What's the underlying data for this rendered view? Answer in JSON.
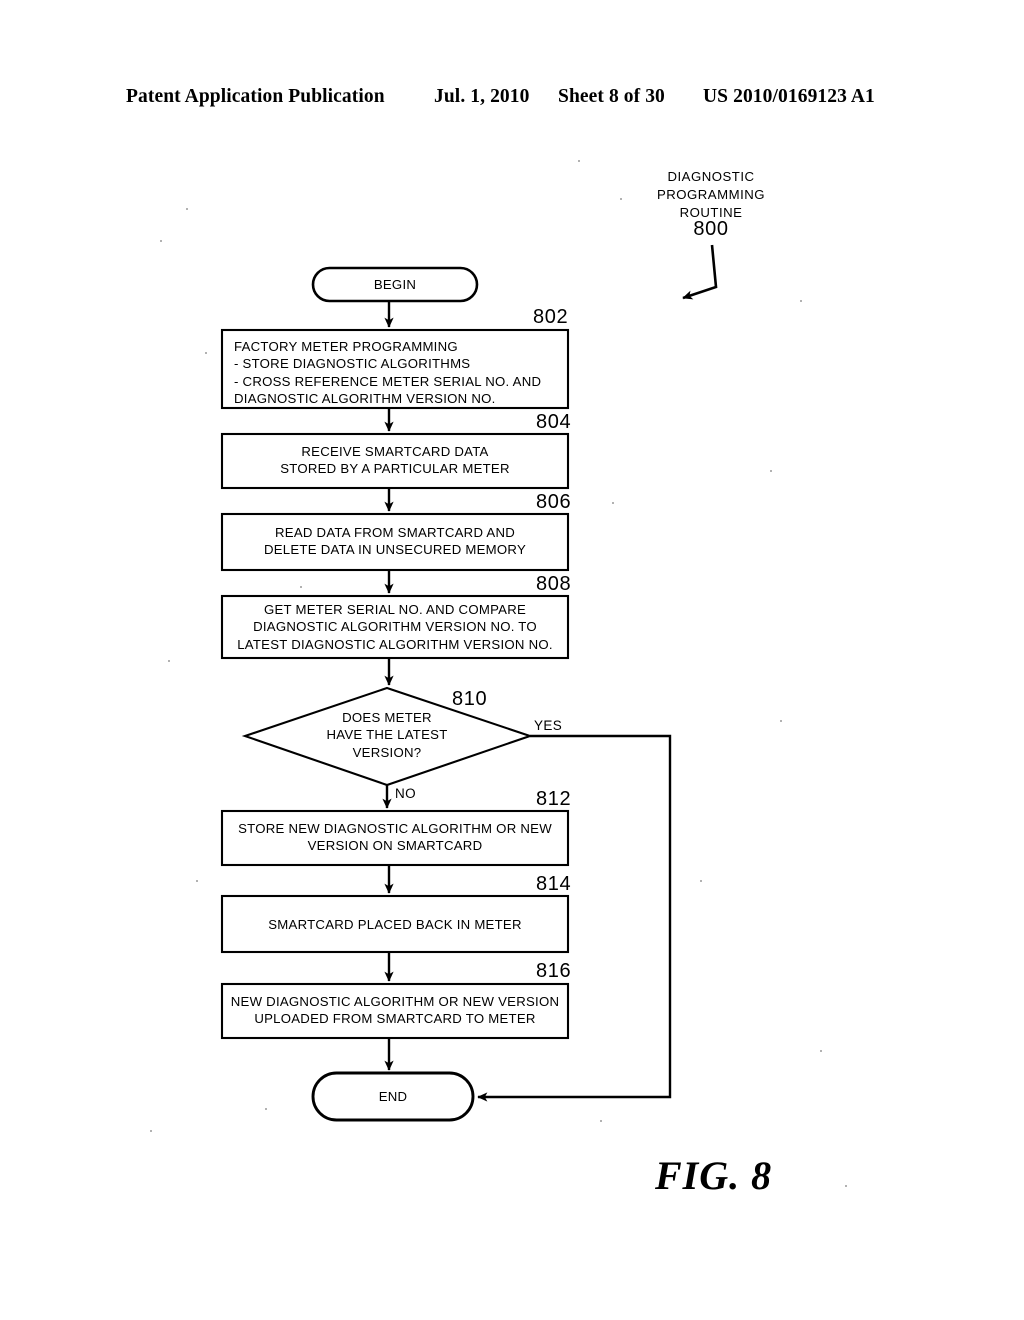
{
  "header": {
    "title": "Patent Application Publication",
    "date": "Jul. 1, 2010",
    "sheet": "Sheet 8 of 30",
    "publication_number": "US 2010/0169123 A1"
  },
  "figure": {
    "caption": "FIG. 8",
    "routine_label": "DIAGNOSTIC\nPROGRAMMING\nROUTINE",
    "routine_number": "800"
  },
  "flowchart": {
    "type": "flowchart",
    "nodes": [
      {
        "id": "begin",
        "shape": "terminator",
        "ref": "",
        "text": "BEGIN"
      },
      {
        "id": "802",
        "shape": "process",
        "ref": "802",
        "text": "FACTORY METER PROGRAMMING\n  - STORE DIAGNOSTIC ALGORITHMS\n  - CROSS REFERENCE METER SERIAL NO. AND\n      DIAGNOSTIC ALGORITHM VERSION NO."
      },
      {
        "id": "804",
        "shape": "process",
        "ref": "804",
        "text": "RECEIVE SMARTCARD DATA\nSTORED BY A PARTICULAR METER"
      },
      {
        "id": "806",
        "shape": "process",
        "ref": "806",
        "text": "READ DATA FROM SMARTCARD AND\nDELETE DATA IN UNSECURED MEMORY"
      },
      {
        "id": "808",
        "shape": "process",
        "ref": "808",
        "text": "GET METER SERIAL NO. AND COMPARE\nDIAGNOSTIC ALGORITHM VERSION NO. TO\nLATEST  DIAGNOSTIC ALGORITHM  VERSION NO."
      },
      {
        "id": "810",
        "shape": "decision",
        "ref": "810",
        "text": "DOES METER\nHAVE THE LATEST\nVERSION?"
      },
      {
        "id": "812",
        "shape": "process",
        "ref": "812",
        "text": "STORE NEW DIAGNOSTIC ALGORITHM  OR NEW\nVERSION ON SMARTCARD"
      },
      {
        "id": "814",
        "shape": "process",
        "ref": "814",
        "text": "SMARTCARD PLACED BACK IN METER"
      },
      {
        "id": "816",
        "shape": "process",
        "ref": "816",
        "text": "NEW  DIAGNOSTIC ALGORITHM  OR NEW VERSION\nUPLOADED FROM SMARTCARD TO METER"
      },
      {
        "id": "end",
        "shape": "terminator",
        "ref": "",
        "text": "END"
      }
    ],
    "branch_labels": {
      "yes": "YES",
      "no": "NO"
    },
    "edges": [
      {
        "from": "begin",
        "to": "802",
        "label": ""
      },
      {
        "from": "802",
        "to": "804",
        "label": ""
      },
      {
        "from": "804",
        "to": "806",
        "label": ""
      },
      {
        "from": "806",
        "to": "808",
        "label": ""
      },
      {
        "from": "808",
        "to": "810",
        "label": ""
      },
      {
        "from": "810",
        "to": "812",
        "label": "NO"
      },
      {
        "from": "810",
        "to": "end",
        "label": "YES"
      },
      {
        "from": "812",
        "to": "814",
        "label": ""
      },
      {
        "from": "814",
        "to": "816",
        "label": ""
      },
      {
        "from": "816",
        "to": "end",
        "label": ""
      }
    ]
  },
  "colors": {
    "ink": "#000000",
    "page": "#ffffff"
  }
}
